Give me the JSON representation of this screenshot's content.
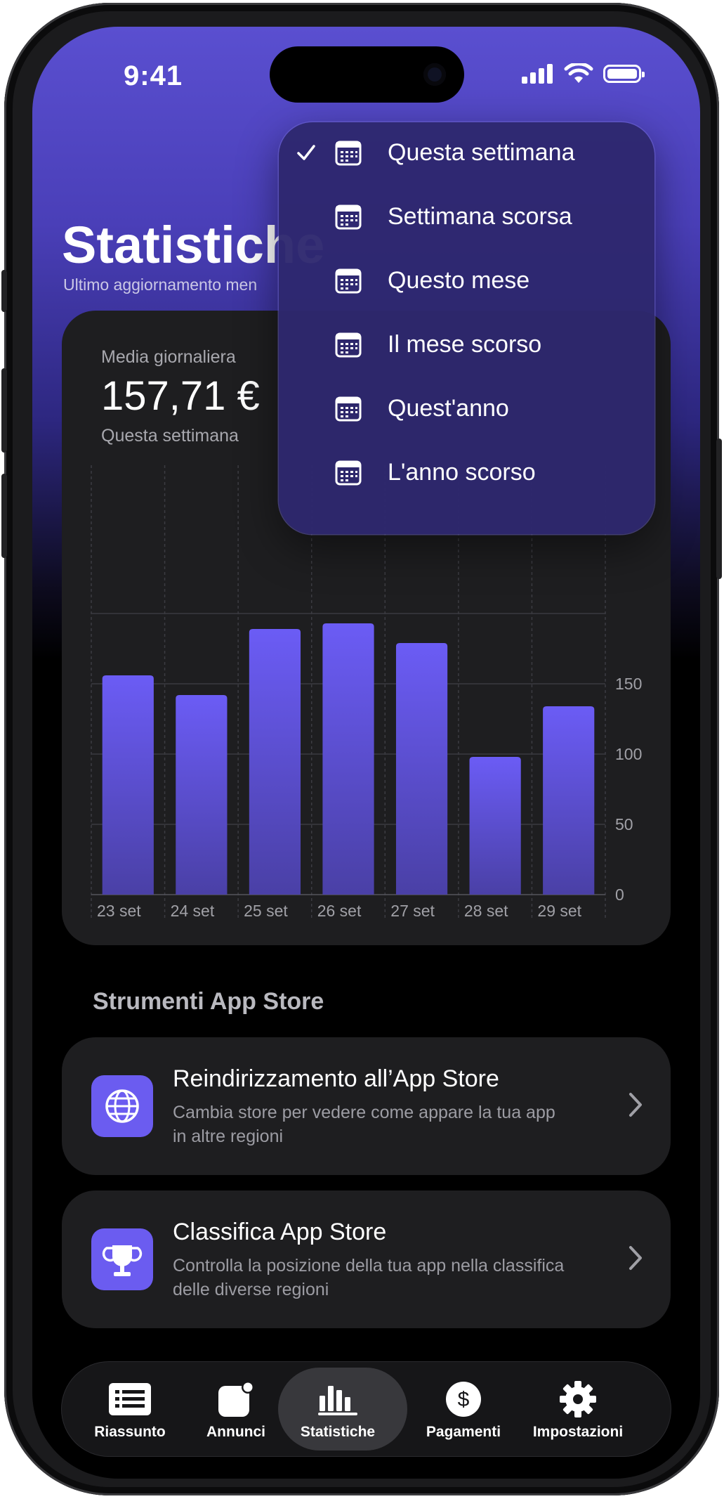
{
  "status_bar": {
    "time": "9:41"
  },
  "header": {
    "title": "Statistiche",
    "subtitle": "Ultimo aggiornamento men"
  },
  "summary": {
    "label": "Media giornaliera",
    "value": "157,71 €",
    "period": "Questa settimana"
  },
  "chart_data": {
    "type": "bar",
    "categories": [
      "23 set",
      "24 set",
      "25 set",
      "26 set",
      "27 set",
      "28 set",
      "29 set"
    ],
    "values": [
      156,
      142,
      189,
      193,
      179,
      98,
      134
    ],
    "y_ticks": [
      0,
      50,
      100,
      150
    ],
    "ylim": [
      0,
      224
    ],
    "grid": true,
    "bar_color": "#6b5cf5",
    "y_axis_side": "right"
  },
  "tools": {
    "section_title": "Strumenti App Store",
    "items": [
      {
        "title": "Reindirizzamento all’App Store",
        "description": "Cambia store per vedere come appare la tua app in altre regioni",
        "icon": "globe-icon"
      },
      {
        "title": "Classifica App Store",
        "description": "Controlla la posizione della tua app nella classifica delle diverse regioni",
        "icon": "trophy-icon"
      }
    ]
  },
  "tabbar": {
    "tabs": [
      {
        "label": "Riassunto",
        "icon": "list-icon",
        "active": false
      },
      {
        "label": "Annunci",
        "icon": "badge-icon",
        "active": false
      },
      {
        "label": "Statistiche",
        "icon": "bar-chart-icon",
        "active": true
      },
      {
        "label": "Pagamenti",
        "icon": "dollar-icon",
        "active": false
      },
      {
        "label": "Impostazioni",
        "icon": "gear-icon",
        "active": false
      }
    ]
  },
  "period_menu": {
    "selected": "Questa settimana",
    "options": [
      "Questa settimana",
      "Settimana scorsa",
      "Questo mese",
      "Il mese scorso",
      "Quest'anno",
      "L'anno scorso"
    ]
  },
  "colors": {
    "accent": "#6b5cf0",
    "header_gradient_top": "#5a4fd0",
    "card_bg": "#1e1e20",
    "menu_bg": "#2e286e"
  }
}
